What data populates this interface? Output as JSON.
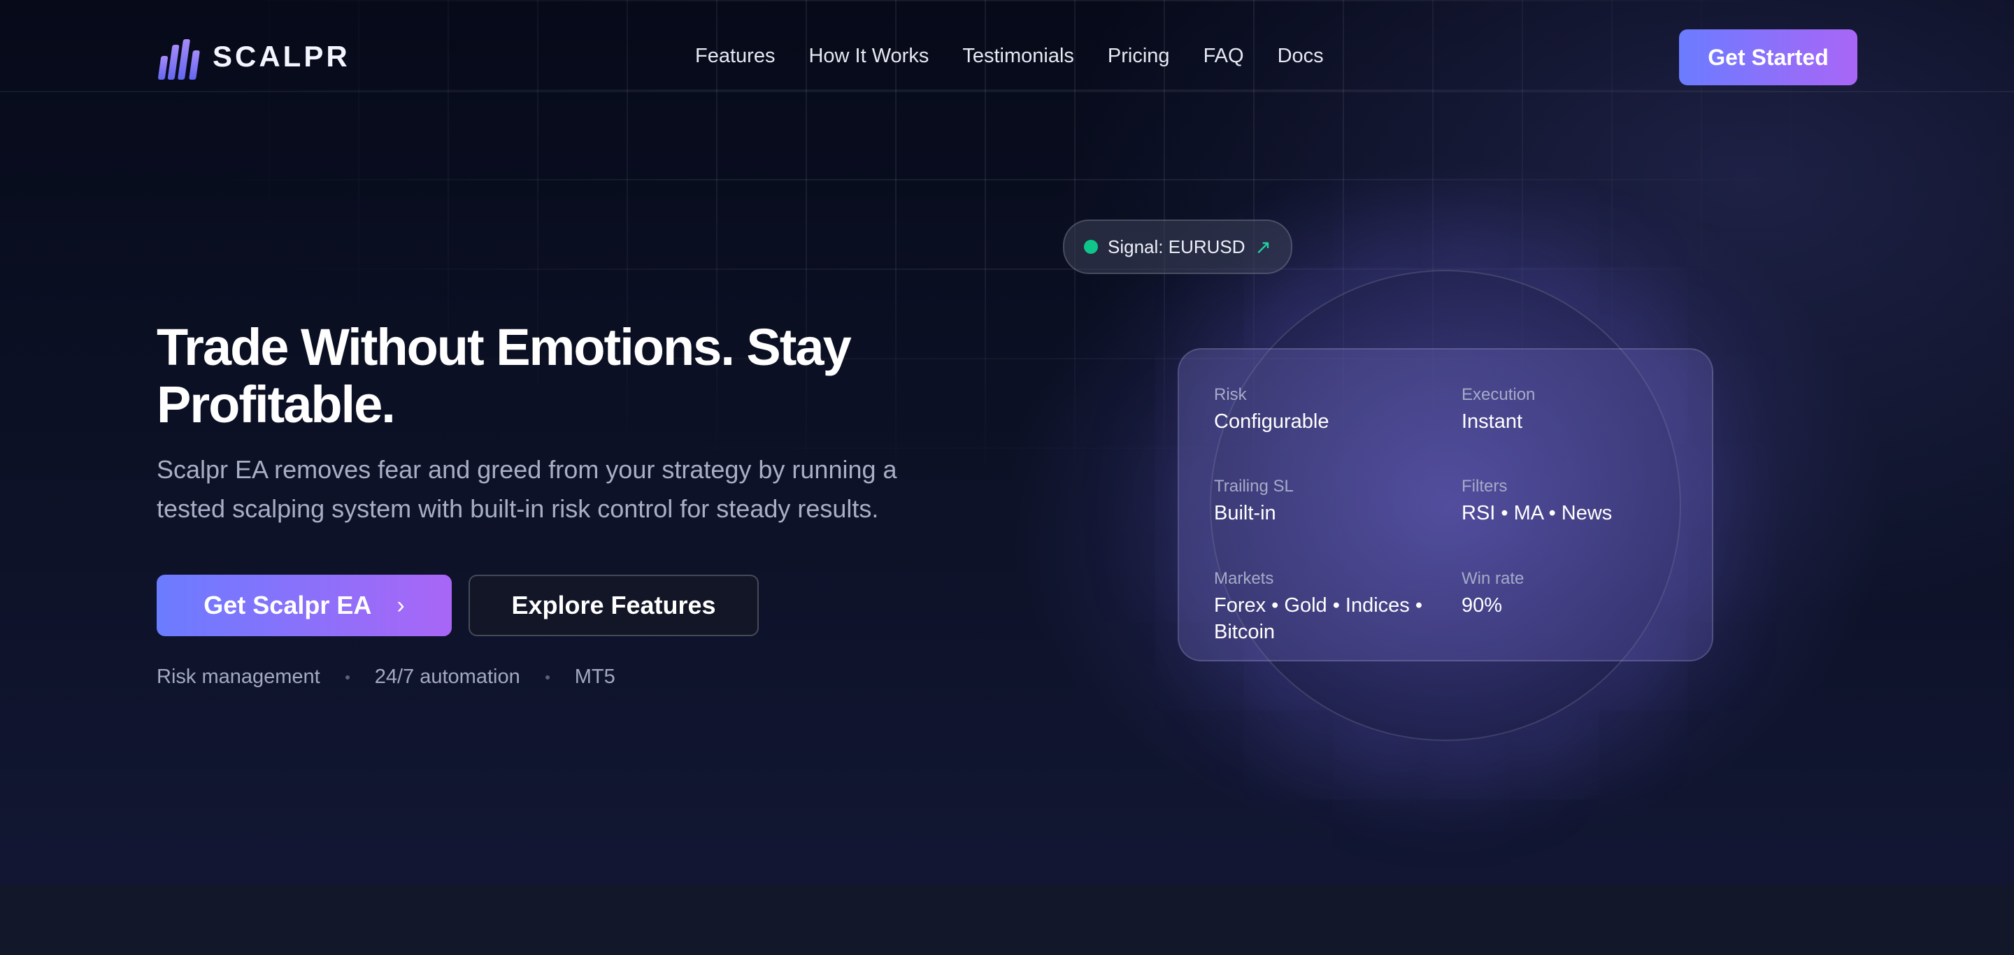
{
  "brand": {
    "name": "SCALPR",
    "accent_start": "#6b7cff",
    "accent_end": "#a966f6"
  },
  "nav": {
    "links": [
      "Features",
      "How It Works",
      "Testimonials",
      "Pricing",
      "FAQ",
      "Docs"
    ],
    "cta": "Get Started"
  },
  "hero": {
    "title": "Trade Without Emotions. Stay Profitable.",
    "subtitle": "Scalpr EA removes fear and greed from your strategy by running a tested scalping system with built-in risk control for steady results.",
    "primary_cta": "Get Scalpr EA",
    "secondary_cta": "Explore Features",
    "tags": [
      "Risk management",
      "24/7 automation",
      "MT5"
    ]
  },
  "signal": {
    "text": "Signal: EURUSD",
    "status_color": "#10c58a"
  },
  "stats": [
    {
      "label": "Risk",
      "value": "Configurable"
    },
    {
      "label": "Execution",
      "value": "Instant"
    },
    {
      "label": "Trailing SL",
      "value": "Built-in"
    },
    {
      "label": "Filters",
      "value": "RSI • MA • News"
    },
    {
      "label": "Markets",
      "value": "Forex • Gold • Indices • Bitcoin"
    },
    {
      "label": "Win rate",
      "value": "90%"
    }
  ]
}
